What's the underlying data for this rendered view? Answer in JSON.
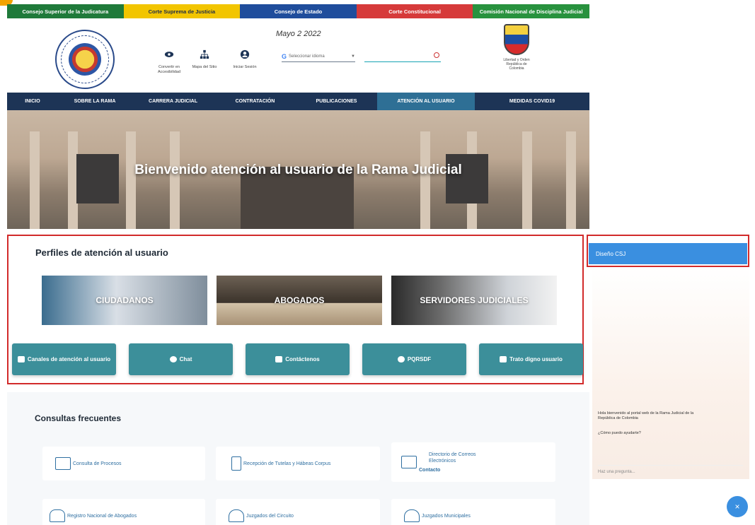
{
  "top_links": [
    {
      "label": "Consejo Superior de la Judicatura",
      "color": "#1f7a3a"
    },
    {
      "label": "Corte Suprema de Justicia",
      "color": "#f2c500"
    },
    {
      "label": "Consejo de Estado",
      "color": "#1f4d9c"
    },
    {
      "label": "Corte Constitucional",
      "color": "#d63a3a"
    },
    {
      "label": "Comisión Nacional de Disciplina Judicial",
      "color": "#28923e"
    }
  ],
  "header": {
    "date": "Mayo 2 2022",
    "tools": [
      {
        "label": "Convertir en Accesibilidad",
        "icon": "eye-icon"
      },
      {
        "label": "Mapa del Sitio",
        "icon": "sitemap-icon"
      },
      {
        "label": "Iniciar Sesión",
        "icon": "user-icon"
      }
    ],
    "translate_label": "Seleccionar idioma",
    "shield_caption": "Libertad y Orden República de Colombia"
  },
  "nav": {
    "items": [
      "INICIO",
      "SOBRE LA RAMA",
      "CARRERA JUDICIAL",
      "CONTRATACIÓN",
      "PUBLICACIONES",
      "ATENCIÓN AL USUARIO",
      "MEDIDAS COVID19"
    ],
    "active_index": 5
  },
  "hero": {
    "title": "Bienvenido atención al usuario de la Rama Judicial"
  },
  "profiles": {
    "title": "Perfiles de atención al usuario",
    "cards": [
      "CIUDADANOS",
      "ABOGADOS",
      "SERVIDORES JUDICIALES"
    ],
    "buttons": [
      {
        "label": "Canales de atención al usuario",
        "icon": "screen-icon"
      },
      {
        "label": "Chat",
        "icon": "chat-icon"
      },
      {
        "label": "Contáctenos",
        "icon": "mail-icon"
      },
      {
        "label": "PQRSDF",
        "icon": "paperclip-icon"
      },
      {
        "label": "Trato digno usuario",
        "icon": "people-icon"
      }
    ]
  },
  "faq": {
    "title": "Consultas frecuentes",
    "items": [
      {
        "label": "Consulta de Procesos",
        "icon": "monitor-search-icon"
      },
      {
        "label": "Recepción de Tutelas y Hábeas Corpus",
        "icon": "document-lock-icon"
      },
      {
        "label": "Directorio de Correos Electrónicos",
        "sub": "Contacto",
        "icon": "mail-folder-icon"
      },
      {
        "label": "Registro Nacional de Abogados",
        "icon": "scales-icon"
      },
      {
        "label": "Juzgados del Circuito",
        "icon": "building-icon"
      },
      {
        "label": "Juzgados Municipales",
        "icon": "building-icon"
      }
    ]
  },
  "chat": {
    "header": "Diseño CSJ",
    "message_1": "Hola bienvenido al portal web de la Rama Judicial de la República de Colombia",
    "message_2": "¿Cómo puedo ayudarte?",
    "input_placeholder": "Haz una pregunta...",
    "close_symbol": "×"
  }
}
